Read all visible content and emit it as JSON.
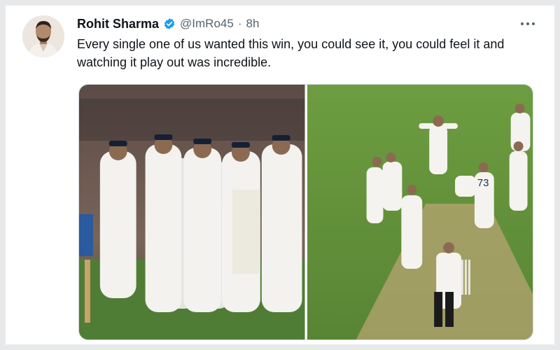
{
  "tweet": {
    "author_name": "Rohit Sharma",
    "author_handle": "@ImRo45",
    "separator": "·",
    "time": "8h",
    "text": "Every single one of us wanted this win, you could see it, you could feel it and watching it play out was incredible.",
    "verified": true,
    "more_icon": "more-horizontal-icon",
    "verified_icon": "verified-badge-icon",
    "media": [
      {
        "subject": "team-walking-photo"
      },
      {
        "subject": "celebration-on-pitch-photo",
        "jersey_number": "73"
      }
    ]
  },
  "colors": {
    "verified": "#1d9bf0",
    "text_primary": "#0f1419",
    "text_secondary": "#536471",
    "field_green": "#5e8f3a"
  }
}
